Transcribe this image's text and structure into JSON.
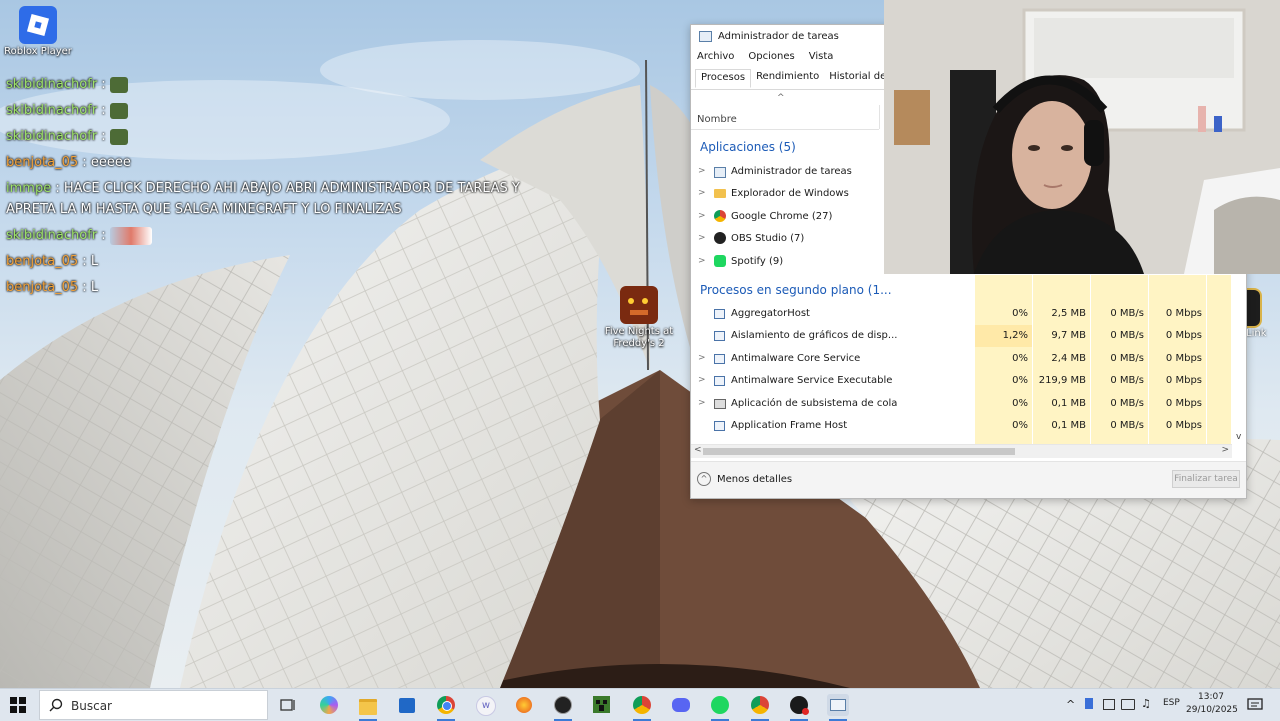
{
  "desktop": {
    "icons": [
      {
        "label": "Roblox Player"
      },
      {
        "label": "Five Nights at Freddy's 2"
      }
    ],
    "partial_icon_label": "Link"
  },
  "chat": {
    "messages": [
      {
        "user": "skibidinachofr",
        "text": ""
      },
      {
        "user": "skibidinachofr",
        "text": ""
      },
      {
        "user": "skibidinachofr",
        "text": ""
      },
      {
        "user": "benjota_05",
        "text": "eeeee"
      },
      {
        "user": "immpe",
        "text": "HACE CLICK DERECHO AHI ABAJO ABRI ADMINISTRADOR DE TAREAS Y APRETA LA M HASTA QUE SALGA MINECRAFT Y LO FINALIZAS"
      },
      {
        "user": "skibidinachofr",
        "text": ""
      },
      {
        "user": "benjota_05",
        "text": "L"
      },
      {
        "user": "benjota_05",
        "text": "L"
      }
    ],
    "colors": {
      "green": "#9ee36a",
      "orange": "#f2a23a"
    }
  },
  "task_manager": {
    "title": "Administrador de tareas",
    "menu": [
      "Archivo",
      "Opciones",
      "Vista"
    ],
    "tabs": [
      "Procesos",
      "Rendimiento",
      "Historial de aplica"
    ],
    "column_name": "Nombre",
    "apps_group": "Aplicaciones (5)",
    "apps": [
      {
        "name": "Administrador de tareas",
        "icon": "taskmanager-icon"
      },
      {
        "name": "Explorador de Windows",
        "icon": "folder-icon"
      },
      {
        "name": "Google Chrome (27)",
        "icon": "chrome-icon"
      },
      {
        "name": "OBS Studio (7)",
        "icon": "obs-icon"
      },
      {
        "name": "Spotify (9)",
        "icon": "spotify-icon"
      }
    ],
    "bg_group": "Procesos en segundo plano (1...",
    "processes": [
      {
        "name": "AggregatorHost",
        "cpu": "0%",
        "mem": "2,5 MB",
        "disk": "0 MB/s",
        "net": "0 Mbps"
      },
      {
        "name": "Aislamiento de gráficos de disp...",
        "cpu": "1,2%",
        "mem": "9,7 MB",
        "disk": "0 MB/s",
        "net": "0 Mbps"
      },
      {
        "name": "Antimalware Core Service",
        "cpu": "0%",
        "mem": "2,4 MB",
        "disk": "0 MB/s",
        "net": "0 Mbps"
      },
      {
        "name": "Antimalware Service Executable",
        "cpu": "0%",
        "mem": "219,9 MB",
        "disk": "0 MB/s",
        "net": "0 Mbps"
      },
      {
        "name": "Aplicación de subsistema de cola",
        "cpu": "0%",
        "mem": "0,1 MB",
        "disk": "0 MB/s",
        "net": "0 Mbps"
      },
      {
        "name": "Application Frame Host",
        "cpu": "0%",
        "mem": "0,1 MB",
        "disk": "0 MB/s",
        "net": "0 Mbps"
      }
    ],
    "less_details": "Menos detalles",
    "end_task": "Finalizar tarea"
  },
  "taskbar": {
    "search_placeholder": "Buscar",
    "language": "ESP",
    "time": "13:07",
    "date": "29/10/2025"
  }
}
